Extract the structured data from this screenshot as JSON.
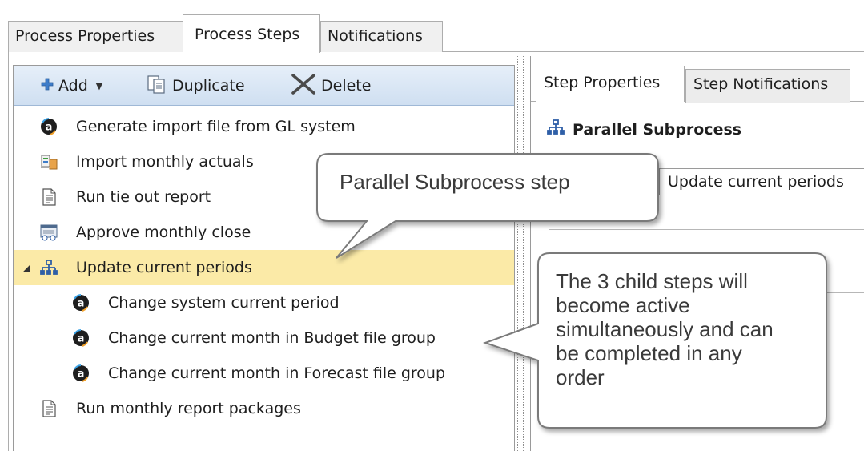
{
  "top_tabs": [
    {
      "label": "Process Properties",
      "active": false
    },
    {
      "label": "Process Steps",
      "active": true
    },
    {
      "label": "Notifications",
      "active": false
    }
  ],
  "toolbar": {
    "add_label": "Add",
    "duplicate_label": "Duplicate",
    "delete_label": "Delete"
  },
  "steps": [
    {
      "label": "Generate import file from GL system",
      "icon": "automated-step-icon"
    },
    {
      "label": "Import monthly actuals",
      "icon": "import-step-icon"
    },
    {
      "label": "Run tie out report",
      "icon": "report-step-icon"
    },
    {
      "label": "Approve monthly close",
      "icon": "approval-step-icon"
    },
    {
      "label": "Update current periods",
      "icon": "parallel-subprocess-icon",
      "selected": true,
      "expanded": true
    },
    {
      "label": "Change system current period",
      "icon": "automated-step-icon",
      "child": true
    },
    {
      "label": "Change current month in Budget file group",
      "icon": "automated-step-icon",
      "child": true
    },
    {
      "label": "Change current month in Forecast file group",
      "icon": "automated-step-icon",
      "child": true
    },
    {
      "label": "Run monthly report packages",
      "icon": "report-step-icon"
    }
  ],
  "right_tabs": [
    {
      "label": "Step Properties",
      "active": true
    },
    {
      "label": "Step Notifications",
      "active": false
    }
  ],
  "step_type_heading": "Parallel Subprocess",
  "step_name_value": "Update current periods",
  "callouts": {
    "callout1": "Parallel Subprocess step",
    "callout2": "The 3 child steps will become active simultaneously and can be completed in any order"
  },
  "colors": {
    "selected_row": "#fbeaa7",
    "toolbar_gradient_top": "#e6eff9",
    "toolbar_gradient_bottom": "#cfdff1",
    "icon_blue": "#2f5fa7"
  }
}
